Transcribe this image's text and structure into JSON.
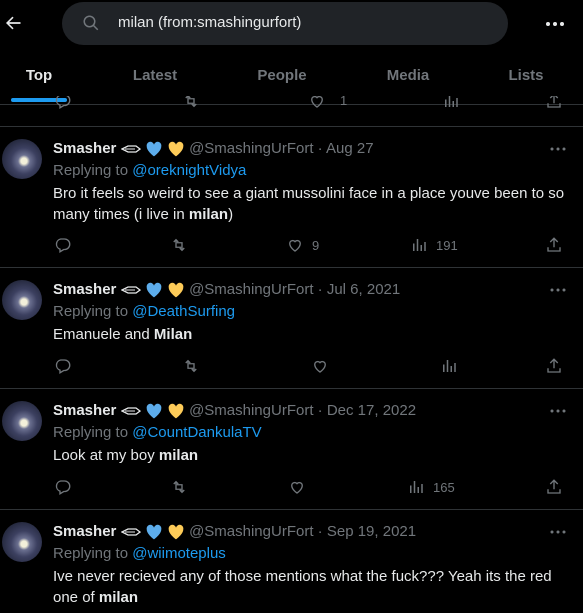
{
  "search": {
    "query": "milan (from:smashingurfort)"
  },
  "tabs": [
    {
      "label": "Top"
    },
    {
      "label": "Latest"
    },
    {
      "label": "People"
    },
    {
      "label": "Media"
    },
    {
      "label": "Lists"
    }
  ],
  "peek": {
    "likes": "1"
  },
  "tweets": [
    {
      "name": "Smasher",
      "handle": "@SmashingUrFort",
      "date": "Aug 27",
      "replying_prefix": "Replying to ",
      "replying_to": "@oreknightVidya",
      "text_before": "Bro it feels so weird to see a giant mussolini face in a place youve been to so many times (i live in ",
      "text_bold": "milan",
      "text_after": ")",
      "likes": "9",
      "views": "191"
    },
    {
      "name": "Smasher",
      "handle": "@SmashingUrFort",
      "date": "Jul 6, 2021",
      "replying_prefix": "Replying to ",
      "replying_to": "@DeathSurfing",
      "text_before": "Emanuele and ",
      "text_bold": "Milan",
      "text_after": "",
      "likes": "",
      "views": ""
    },
    {
      "name": "Smasher",
      "handle": "@SmashingUrFort",
      "date": "Dec 17, 2022",
      "replying_prefix": "Replying to ",
      "replying_to": "@CountDankulaTV",
      "text_before": "Look at my boy ",
      "text_bold": "milan",
      "text_after": "",
      "likes": "",
      "views": "165"
    },
    {
      "name": "Smasher",
      "handle": "@SmashingUrFort",
      "date": "Sep 19, 2021",
      "replying_prefix": "Replying to ",
      "replying_to": "@wiimoteplus",
      "text_before": "Ive never recieved any of those mentions what the fuck??? Yeah its the red one of ",
      "text_bold": "milan",
      "text_after": "",
      "likes": "",
      "views": ""
    }
  ],
  "colors": {
    "accent": "#1d9bf0",
    "muted": "#71767b",
    "text": "#e7e9ea",
    "divider": "#2f3336",
    "background": "#000000"
  },
  "icons": [
    "back-arrow-icon",
    "search-icon",
    "more-icon",
    "reply-icon",
    "retweet-icon",
    "like-icon",
    "views-icon",
    "share-icon"
  ]
}
